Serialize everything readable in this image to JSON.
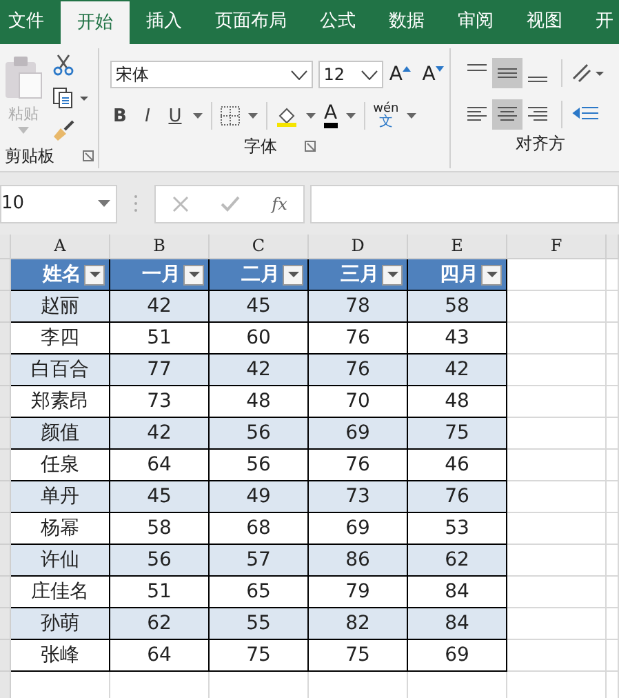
{
  "tabs": [
    {
      "label": "文件",
      "selected": false
    },
    {
      "label": "开始",
      "selected": true
    },
    {
      "label": "插入",
      "selected": false
    },
    {
      "label": "页面布局",
      "selected": false
    },
    {
      "label": "公式",
      "selected": false
    },
    {
      "label": "数据",
      "selected": false
    },
    {
      "label": "审阅",
      "selected": false
    },
    {
      "label": "视图",
      "selected": false
    },
    {
      "label": "开",
      "selected": false
    }
  ],
  "ribbon": {
    "clipboard": {
      "paste": "粘贴",
      "label": "剪贴板"
    },
    "font": {
      "name": "宋体",
      "size": "12",
      "grow": "A",
      "shrink": "A",
      "bold": "B",
      "italic": "I",
      "underline": "U",
      "font_color": "A",
      "phonetic_top": "wén",
      "phonetic_bottom": "文",
      "label": "字体"
    },
    "alignment": {
      "label": "对齐方"
    }
  },
  "formula_bar": {
    "name_box": "10",
    "fx": "fx"
  },
  "column_headers": [
    "A",
    "B",
    "C",
    "D",
    "E",
    "F"
  ],
  "table": {
    "columns": [
      "姓名",
      "一月",
      "二月",
      "三月",
      "四月"
    ],
    "rows": [
      [
        "赵丽",
        "42",
        "45",
        "78",
        "58"
      ],
      [
        "李四",
        "51",
        "60",
        "76",
        "43"
      ],
      [
        "白百合",
        "77",
        "42",
        "76",
        "42"
      ],
      [
        "郑素昂",
        "73",
        "48",
        "70",
        "48"
      ],
      [
        "颜值",
        "42",
        "56",
        "69",
        "75"
      ],
      [
        "任泉",
        "64",
        "56",
        "76",
        "46"
      ],
      [
        "单丹",
        "45",
        "49",
        "73",
        "76"
      ],
      [
        "杨幂",
        "58",
        "68",
        "69",
        "53"
      ],
      [
        "许仙",
        "56",
        "57",
        "86",
        "62"
      ],
      [
        "庄佳名",
        "51",
        "65",
        "79",
        "84"
      ],
      [
        "孙萌",
        "62",
        "55",
        "82",
        "84"
      ],
      [
        "张峰",
        "64",
        "75",
        "75",
        "69"
      ]
    ]
  }
}
